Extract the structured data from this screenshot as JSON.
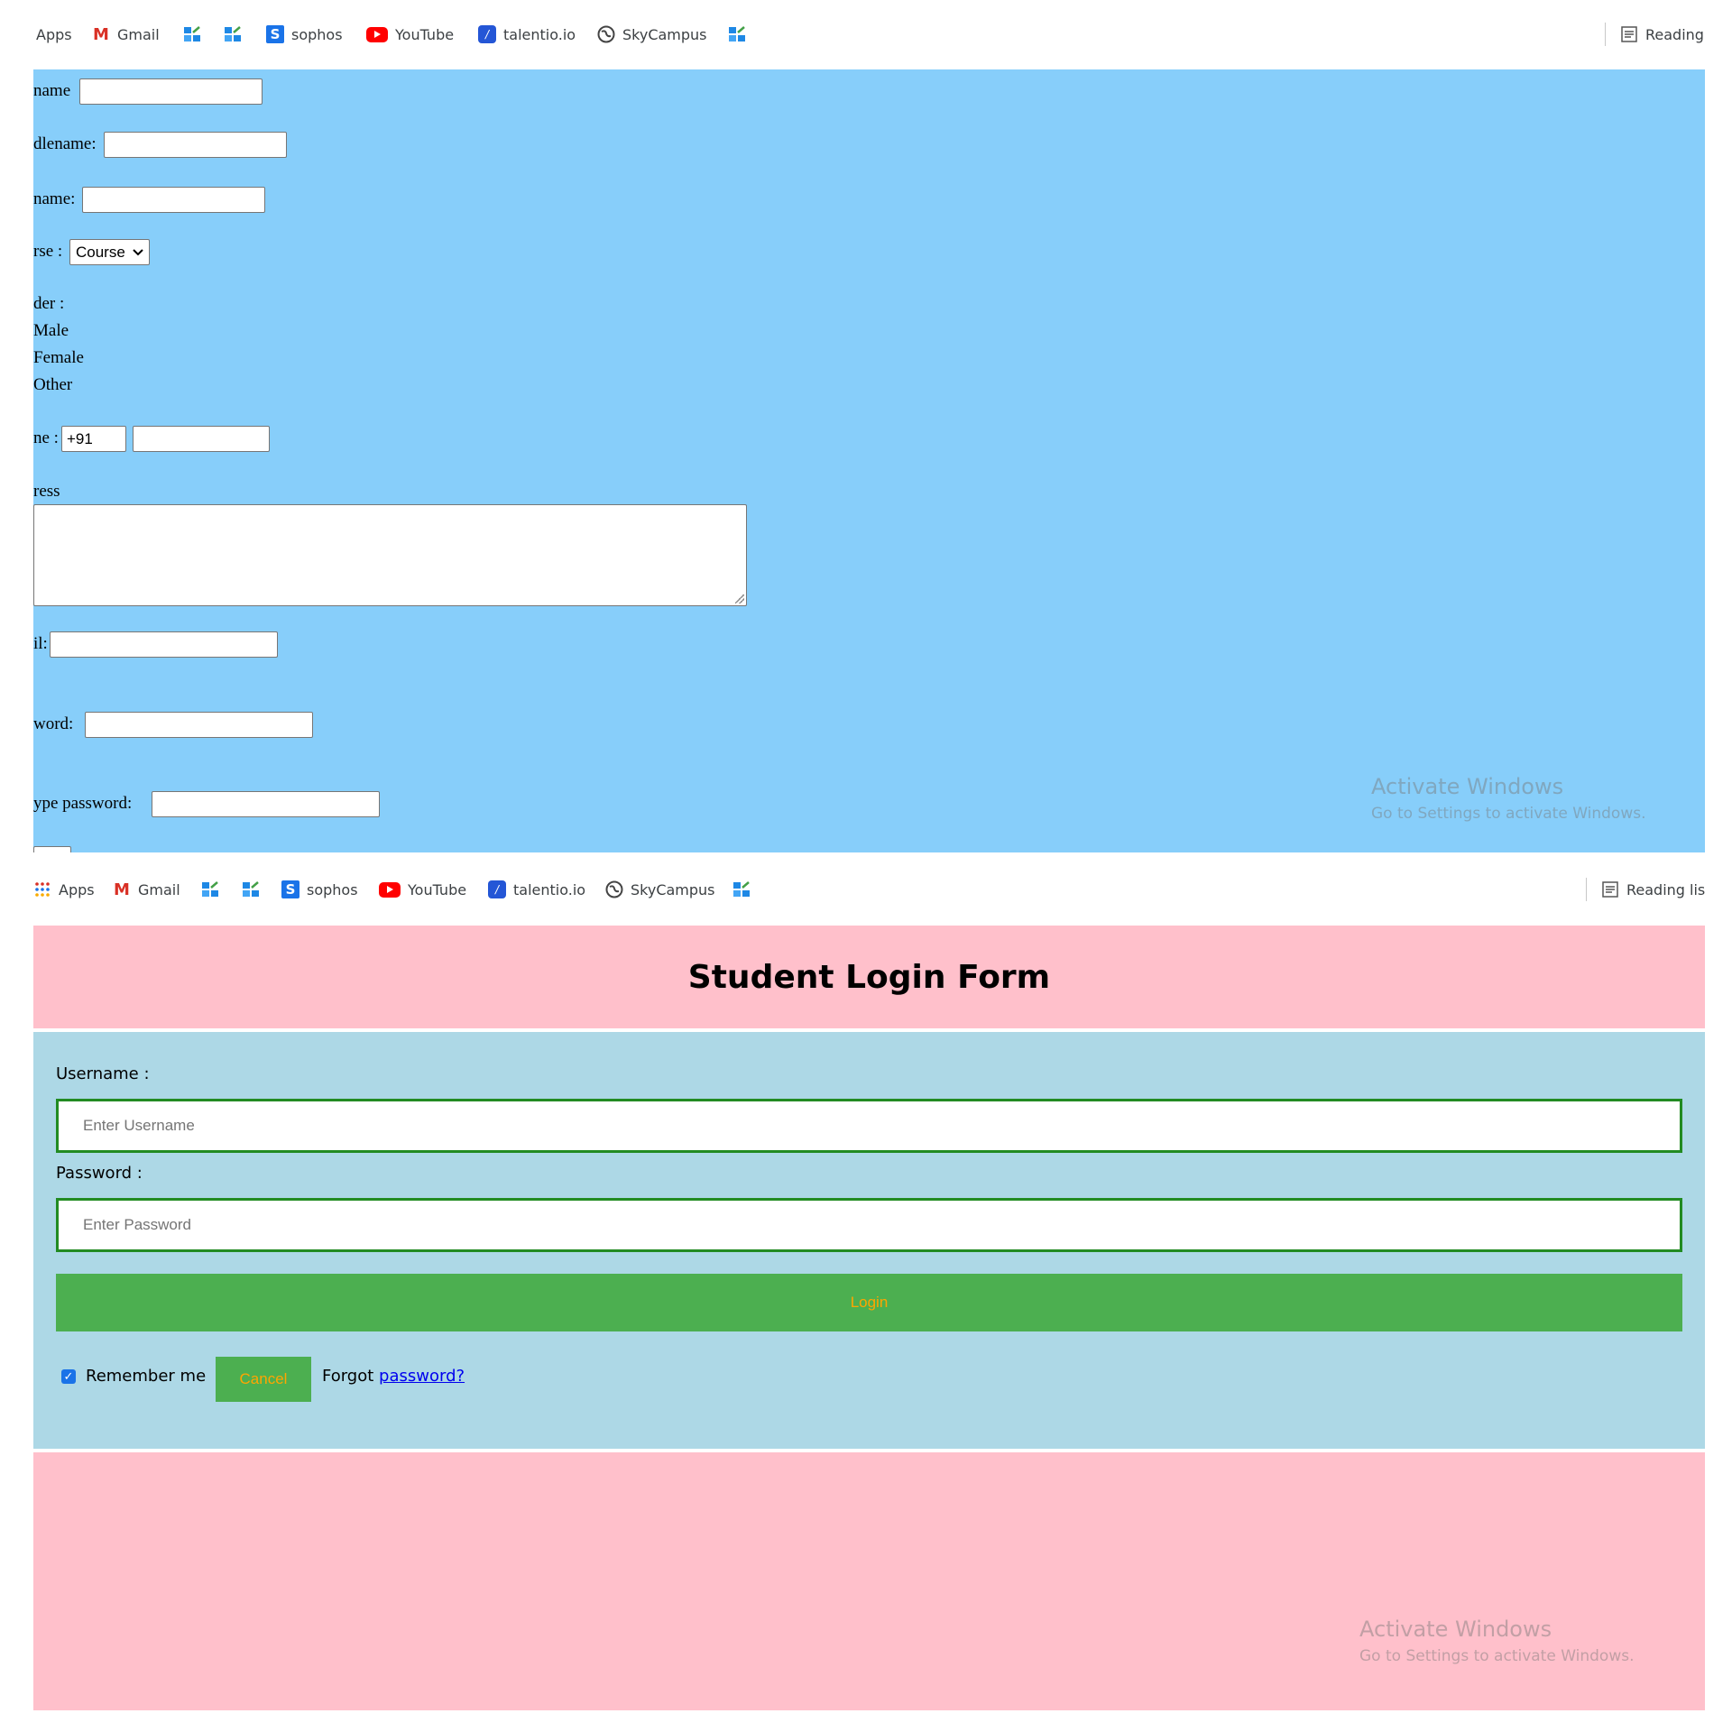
{
  "bookmarks": {
    "apps": "Apps",
    "gmail": "Gmail",
    "sophos": "sophos",
    "youtube": "YouTube",
    "talentio": "talentio.io",
    "skycampus": "SkyCampus",
    "reading_top": "Reading",
    "reading_bottom": "Reading lis"
  },
  "registration": {
    "firstname_label": "name",
    "middlename_label": "dlename:",
    "lastname_label": "name:",
    "course_label": "rse :",
    "course_value": "Course",
    "gender_label": "der :",
    "gender_options": [
      "Male",
      "Female",
      "Other"
    ],
    "phone_label": "ne :",
    "phone_code": "+91",
    "address_label": "ress",
    "email_label": "il:",
    "password_label": "word:",
    "retype_label": "ype password:"
  },
  "watermark": {
    "title": "Activate Windows",
    "subtitle": "Go to Settings to activate Windows."
  },
  "login": {
    "title": "Student Login Form",
    "username_label": "Username :",
    "username_placeholder": "Enter Username",
    "password_label": "Password :",
    "password_placeholder": "Enter Password",
    "login_button": "Login",
    "remember_label": "Remember me",
    "cancel_button": "Cancel",
    "forgot_text": "Forgot",
    "forgot_link": "password?"
  },
  "colors": {
    "registration_bg": "#87cefa",
    "header_footer_bg": "#ffc0cb",
    "form_bg": "#add8e6",
    "button_bg": "#4caf50",
    "button_text": "#ffa500",
    "input_border": "#228b22"
  }
}
